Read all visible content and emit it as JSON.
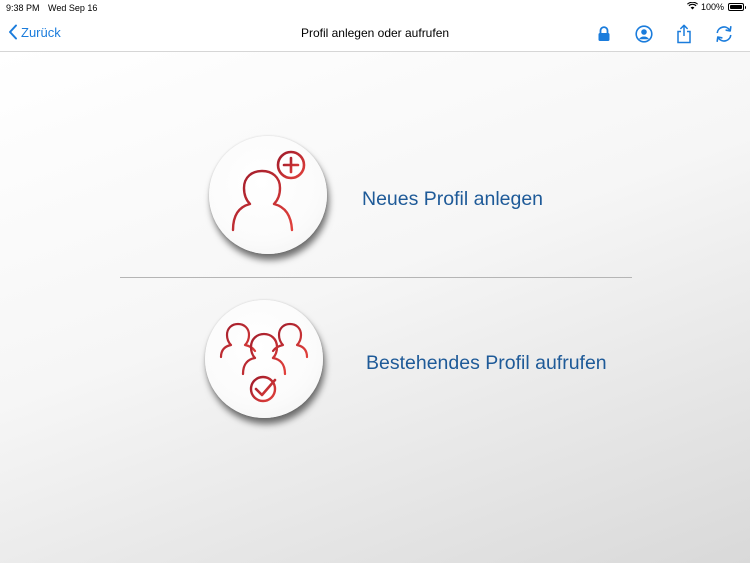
{
  "status_bar": {
    "time": "9:38 PM",
    "date": "Wed Sep 16",
    "battery": "100%",
    "battery_level": 1.0
  },
  "nav": {
    "back_label": "Zurück",
    "title": "Profil anlegen oder aufrufen",
    "icons": [
      "lock-icon",
      "profile-icon",
      "share-icon",
      "sync-icon"
    ],
    "accent_color": "#1a7cdc"
  },
  "options": [
    {
      "label": "Neues Profil anlegen",
      "icon": "add-profile-icon"
    },
    {
      "label": "Bestehendes Profil aufrufen",
      "icon": "group-check-icon"
    }
  ],
  "colors": {
    "label": "#1e5a98",
    "icon_red": "#c0202c"
  }
}
